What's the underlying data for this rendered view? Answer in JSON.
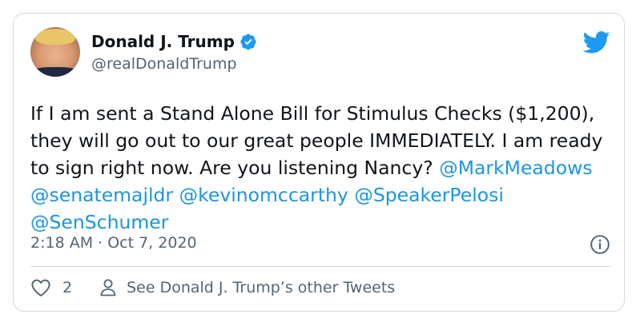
{
  "author": {
    "display_name": "Donald J. Trump",
    "handle": "@realDonaldTrump",
    "verified": true
  },
  "tweet": {
    "text_plain": "If I am sent a Stand Alone Bill for Stimulus Checks ($1,200), they will go out to our great people IMMEDIATELY. I am ready to sign right now. Are you listening Nancy?",
    "mentions": [
      "@MarkMeadows",
      "@senatemajldr",
      "@kevinomccarthy",
      "@SpeakerPelosi",
      "@SenSchumer"
    ],
    "timestamp": "2:18 AM · Oct 7, 2020"
  },
  "actions": {
    "like_count": "2",
    "see_others_label": "See Donald J. Trump’s other Tweets"
  },
  "icons": {
    "avatar": "profile-photo",
    "verified": "verified-badge-icon",
    "brand": "twitter-bird-icon",
    "info": "info-icon",
    "like": "heart-icon",
    "profile": "person-icon"
  },
  "colors": {
    "link": "#1b95e0",
    "brand": "#1d9bf0",
    "secondary_text": "#536471",
    "border": "#cfd9de"
  }
}
